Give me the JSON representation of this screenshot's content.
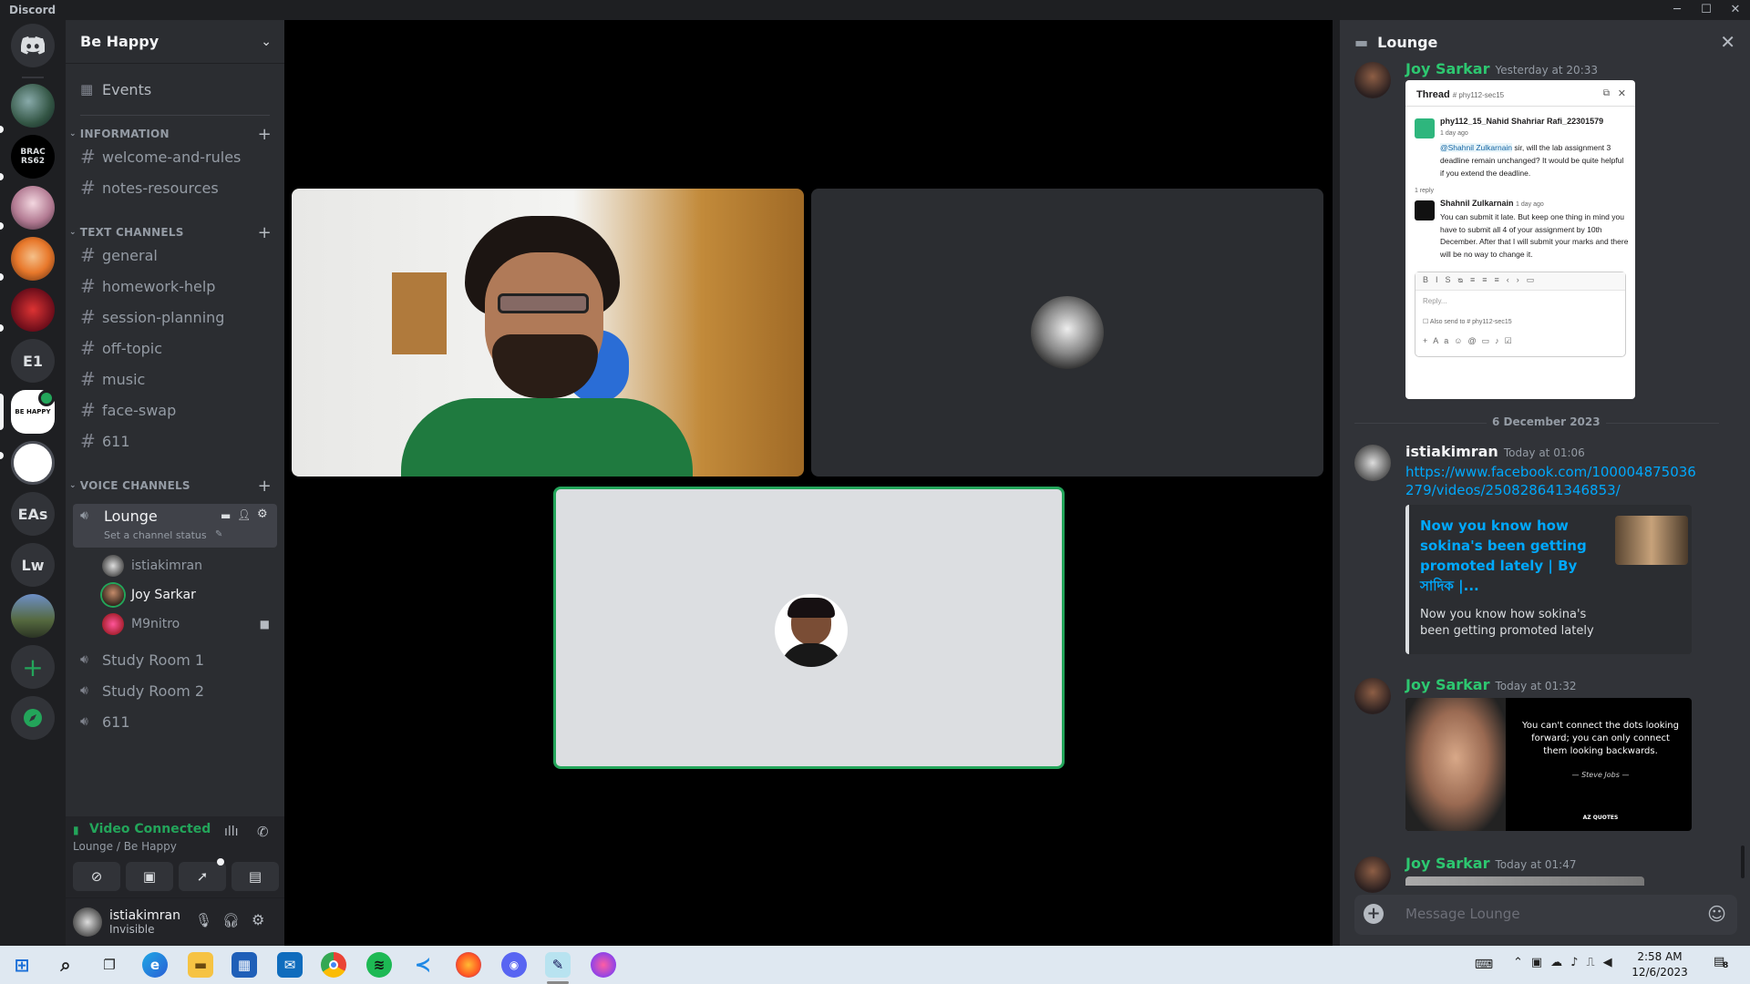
{
  "window": {
    "app_title": "Discord"
  },
  "guilds": {
    "items": [
      {
        "label": "",
        "type": "home"
      },
      {
        "label": "",
        "type": "avatar"
      },
      {
        "label": "BRAC RS62",
        "type": "text"
      },
      {
        "label": "",
        "type": "avatar"
      },
      {
        "label": "",
        "type": "avatar"
      },
      {
        "label": "",
        "type": "avatar"
      },
      {
        "label": "E1",
        "type": "text"
      },
      {
        "label": "BE HAPPY",
        "type": "text"
      },
      {
        "label": "",
        "type": "avatar"
      },
      {
        "label": "EAs",
        "type": "text"
      },
      {
        "label": "Lw",
        "type": "text"
      },
      {
        "label": "",
        "type": "avatar"
      }
    ],
    "add_icon": "plus-icon",
    "explore_icon": "compass-icon"
  },
  "server": {
    "name": "Be Happy",
    "events_label": "Events",
    "categories": {
      "information": "INFORMATION",
      "text": "TEXT CHANNELS",
      "voice": "VOICE CHANNELS"
    },
    "info_channels": [
      "welcome-and-rules",
      "notes-resources"
    ],
    "text_channels": [
      "general",
      "homework-help",
      "session-planning",
      "off-topic",
      "music",
      "face-swap",
      "611"
    ],
    "voice": {
      "lounge": "Lounge",
      "lounge_status": "Set a channel status",
      "lounge_users": [
        "istiakimran",
        "Joy Sarkar",
        "M9nitro"
      ],
      "others": [
        "Study Room 1",
        "Study Room 2",
        "611"
      ]
    }
  },
  "voice_panel": {
    "status": "Video Connected",
    "location": "Lounge / Be Happy"
  },
  "user": {
    "name": "istiakimran",
    "status": "Invisible"
  },
  "thread_panel": {
    "title": "Lounge",
    "message_placeholder": "Message Lounge",
    "date_divider": "6 December 2023",
    "messages": [
      {
        "author": "Joy Sarkar",
        "time": "Yesterday at 20:33"
      },
      {
        "author": "istiakimran",
        "time": "Today at 01:06",
        "link": "https://www.facebook.com/100004875036279/videos/250828641346853/",
        "embed_title": "Now you know how sokina's been getting promoted lately | By সাদিক |...",
        "embed_desc": "Now you know how sokina's been getting promoted lately"
      },
      {
        "author": "Joy Sarkar",
        "time": "Today at 01:32",
        "quote": "You can't connect the dots looking forward; you can only connect them looking backwards.",
        "quote_author": "— Steve Jobs —",
        "quote_brand": "AZ QUOTES"
      },
      {
        "author": "Joy Sarkar",
        "time": "Today at 01:47"
      }
    ],
    "embedded_thread": {
      "label": "Thread",
      "channel": "# phy112-sec15",
      "post_author": "phy112_15_Nahid Shahriar Rafi_22301579",
      "post_time": "1 day ago",
      "post_mention": "@Shahnil Zulkarnain",
      "post_text": "sir, will the lab assignment 3 deadline remain unchanged? It would be quite helpful if you extend the deadline.",
      "replies": "1 reply",
      "reply_author": "Shahnil Zulkarnain",
      "reply_time": "1 day ago",
      "reply_text": "You can submit it late. But keep one thing in mind you have to submit all 4 of your assignment by 10th December. After that I will submit your marks and there will be no way to change it.",
      "reply_placeholder": "Reply...",
      "also_send": "Also send to # phy112-sec15"
    }
  },
  "taskbar": {
    "time": "2:58 AM",
    "date": "12/6/2023",
    "notification_count": "8"
  },
  "colors": {
    "discord_green": "#23a55a",
    "link_blue": "#00a8fc",
    "joy_green": "#2dc770"
  }
}
